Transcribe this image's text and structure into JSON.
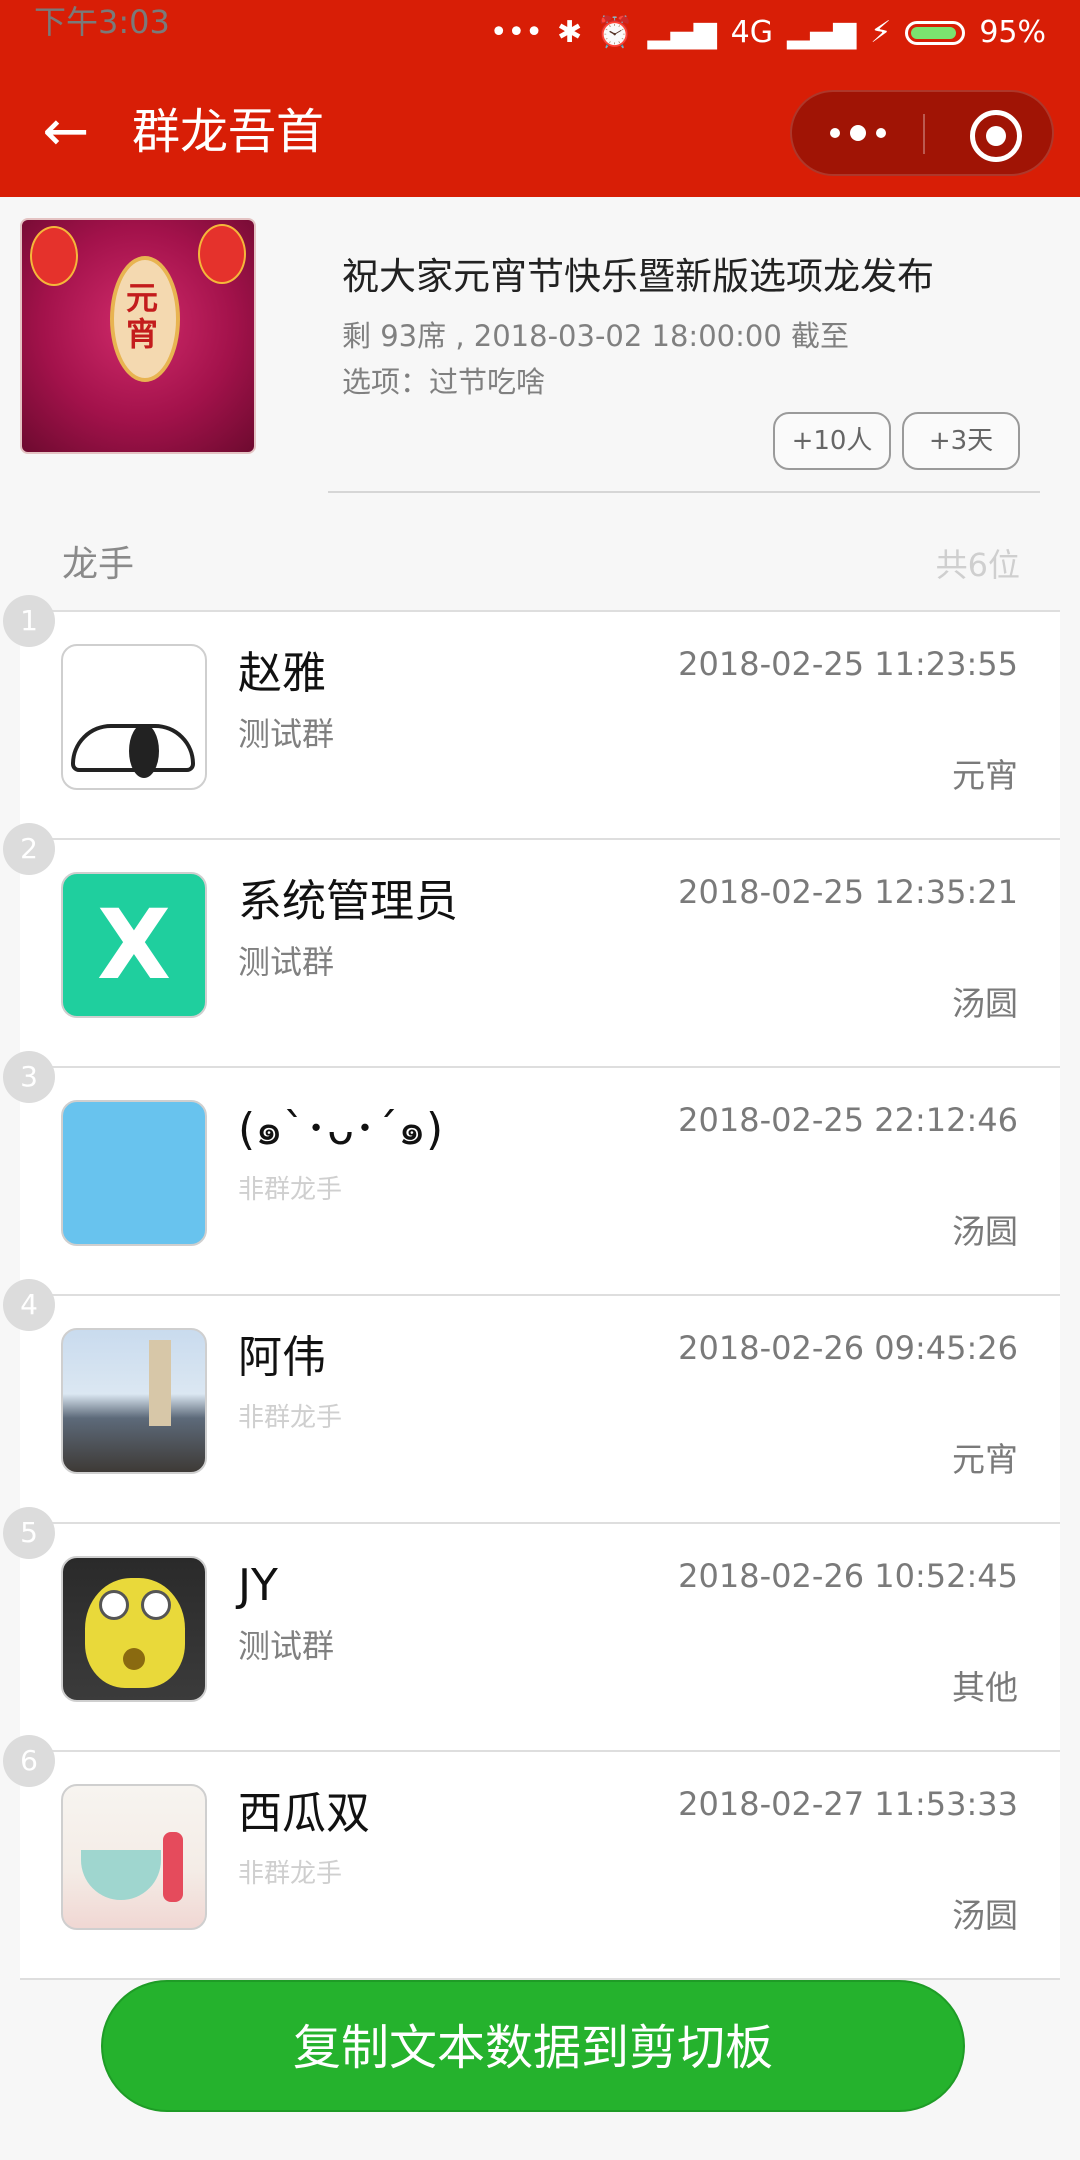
{
  "status_bar": {
    "time": "下午3:03",
    "network": "4G",
    "battery": "95%",
    "battery_color": "#7be36f"
  },
  "nav": {
    "back_icon": "arrow-left-icon",
    "title": "群龙吾首",
    "more_icon": "more-dots-icon",
    "close_icon": "target-circle-icon",
    "bar_color": "#d81e06"
  },
  "event": {
    "title": "祝大家元宵节快乐暨新版选项龙发布",
    "meta": "剩 93席 , 2018-03-02 18:00:00 截至",
    "option": "选项：过节吃啥",
    "add_people": "+10人",
    "add_days": "+3天",
    "image_glyph": "元宵"
  },
  "section": {
    "label": "龙手",
    "count": "共6位"
  },
  "entries": [
    {
      "index": "1",
      "name": "赵雅",
      "group": "测试群",
      "time": "2018-02-25 11:23:55",
      "choice": "元宵"
    },
    {
      "index": "2",
      "name": "系统管理员",
      "group": "测试群",
      "time": "2018-02-25 12:35:21",
      "choice": "汤圆",
      "avatar_letter": "X"
    },
    {
      "index": "3",
      "name": "(๑`･ᴗ･´๑)",
      "group": "非群龙手",
      "time": "2018-02-25 22:12:46",
      "choice": "汤圆"
    },
    {
      "index": "4",
      "name": "阿伟",
      "group": "非群龙手",
      "time": "2018-02-26 09:45:26",
      "choice": "元宵"
    },
    {
      "index": "5",
      "name": "JY",
      "group": "测试群",
      "time": "2018-02-26 10:52:45",
      "choice": "其他"
    },
    {
      "index": "6",
      "name": "西瓜双",
      "group": "非群龙手",
      "time": "2018-02-27 11:53:33",
      "choice": "汤圆"
    }
  ],
  "copy_button": {
    "label": "复制文本数据到剪切板",
    "color": "#25b22d"
  }
}
